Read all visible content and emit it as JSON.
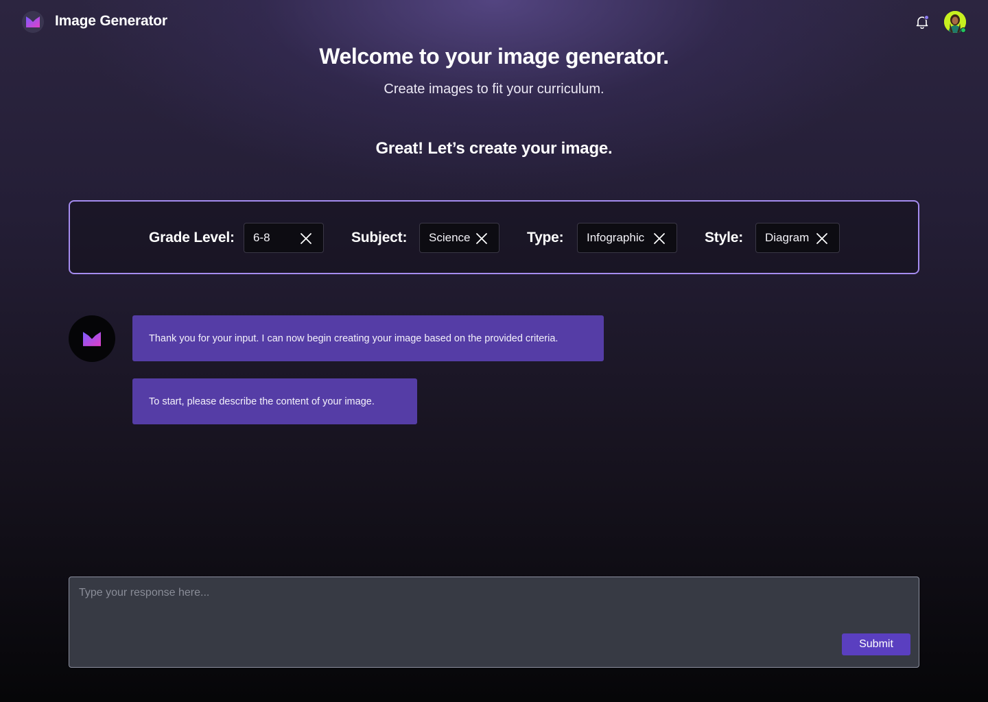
{
  "header": {
    "app_title": "Image Generator",
    "logo_icon": "brand-m-logo-icon",
    "notification_icon": "bell-icon",
    "avatar_icon": "user-avatar"
  },
  "hero": {
    "title": "Welcome to your image generator.",
    "subtitle": "Create images to fit your curriculum.",
    "prompt_heading": "Great! Let’s create your image."
  },
  "criteria": [
    {
      "label": "Grade Level:",
      "value": "6-8"
    },
    {
      "label": "Subject:",
      "value": "Science"
    },
    {
      "label": "Type:",
      "value": "Infographic"
    },
    {
      "label": "Style:",
      "value": "Diagram"
    }
  ],
  "chat": {
    "messages": [
      "Thank you for your input. I can now begin creating your image based on the provided criteria.",
      "To start, please describe the content of your image."
    ]
  },
  "composer": {
    "placeholder": "Type your response here...",
    "submit_label": "Submit"
  },
  "colors": {
    "accent": "#553da6",
    "panel_border": "#a58cf0",
    "submit": "#5a3fc0",
    "logo_gradient_start": "#7b5cff",
    "logo_gradient_end": "#e040c8"
  }
}
